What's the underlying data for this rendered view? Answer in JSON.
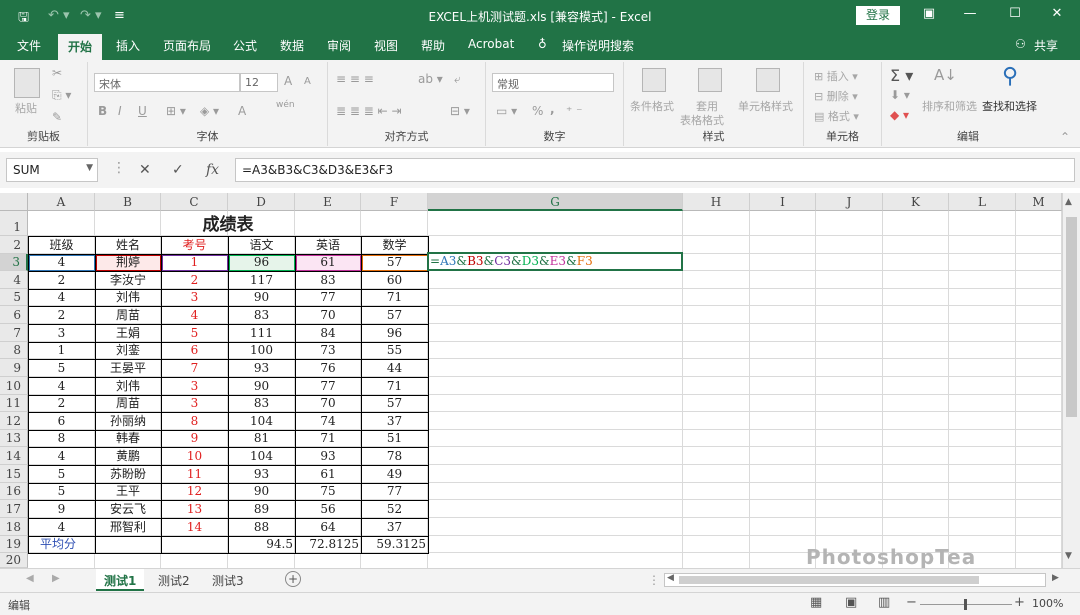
{
  "app": {
    "title": "EXCEL上机测试题.xls [兼容模式] - Excel",
    "login": "登录",
    "share": "共享",
    "tell_me": "操作说明搜索"
  },
  "ribbon_tabs": [
    "文件",
    "开始",
    "插入",
    "页面布局",
    "公式",
    "数据",
    "审阅",
    "视图",
    "帮助",
    "Acrobat"
  ],
  "ribbon": {
    "clipboard": {
      "label": "剪贴板",
      "paste": "粘贴"
    },
    "font": {
      "label": "字体",
      "name": "宋体",
      "size": "12",
      "bold": "B",
      "italic": "I",
      "underline": "U",
      "grow": "A",
      "shrink": "A",
      "color": "A",
      "wen": "wén"
    },
    "alignment": {
      "label": "对齐方式"
    },
    "number": {
      "label": "数字",
      "format": "常规",
      "percent": "%",
      "comma": ","
    },
    "styles": {
      "label": "样式",
      "cond": "条件格式",
      "table": "套用",
      "table2": "表格格式",
      "cell": "单元格样式"
    },
    "cells": {
      "label": "单元格",
      "insert": "插入",
      "delete": "删除",
      "format": "格式"
    },
    "editing": {
      "label": "编辑",
      "sort": "排序和筛选",
      "find": "查找和选择"
    }
  },
  "formula_bar": {
    "name_box": "SUM",
    "cancel": "✕",
    "enter": "✓",
    "fx": "fx",
    "formula": "=A3&B3&C3&D3&E3&F3"
  },
  "columns": [
    "A",
    "B",
    "C",
    "D",
    "E",
    "F",
    "G",
    "H",
    "I",
    "J",
    "K",
    "L",
    "M"
  ],
  "rows": [
    "1",
    "2",
    "3",
    "4",
    "5",
    "6",
    "7",
    "8",
    "9",
    "10",
    "11",
    "12",
    "13",
    "14",
    "15",
    "16",
    "17",
    "18",
    "19",
    "20"
  ],
  "sheet": {
    "title": "成绩表",
    "headers": [
      "班级",
      "姓名",
      "考号",
      "语文",
      "英语",
      "数学"
    ],
    "data": [
      [
        "4",
        "荆婷",
        "1",
        "96",
        "61",
        "57"
      ],
      [
        "2",
        "李汝宁",
        "2",
        "117",
        "83",
        "60"
      ],
      [
        "4",
        "刘伟",
        "3",
        "90",
        "77",
        "71"
      ],
      [
        "2",
        "周苗",
        "4",
        "83",
        "70",
        "57"
      ],
      [
        "3",
        "王娟",
        "5",
        "111",
        "84",
        "96"
      ],
      [
        "1",
        "刘銮",
        "6",
        "100",
        "73",
        "55"
      ],
      [
        "5",
        "王晏平",
        "7",
        "93",
        "76",
        "44"
      ],
      [
        "4",
        "刘伟",
        "3",
        "90",
        "77",
        "71"
      ],
      [
        "2",
        "周苗",
        "3",
        "83",
        "70",
        "57"
      ],
      [
        "6",
        "孙丽纳",
        "8",
        "104",
        "74",
        "37"
      ],
      [
        "8",
        "韩春",
        "9",
        "81",
        "71",
        "51"
      ],
      [
        "4",
        "黄鹏",
        "10",
        "104",
        "93",
        "78"
      ],
      [
        "5",
        "苏盼盼",
        "11",
        "93",
        "61",
        "49"
      ],
      [
        "5",
        "王平",
        "12",
        "90",
        "75",
        "77"
      ],
      [
        "9",
        "安云飞",
        "13",
        "89",
        "56",
        "52"
      ],
      [
        "4",
        "邢智利",
        "14",
        "88",
        "64",
        "37"
      ]
    ],
    "avg_label": "平均分",
    "averages": [
      "94.5",
      "72.8125",
      "59.3125"
    ]
  },
  "formula_cell": [
    {
      "text": "=",
      "color": "#217346"
    },
    {
      "text": "A3",
      "color": "#2e75b6"
    },
    {
      "text": "&",
      "color": "#217346"
    },
    {
      "text": "B3",
      "color": "#c00000"
    },
    {
      "text": "&",
      "color": "#217346"
    },
    {
      "text": "C3",
      "color": "#7030a0"
    },
    {
      "text": "&",
      "color": "#217346"
    },
    {
      "text": "D3",
      "color": "#00b050"
    },
    {
      "text": "&",
      "color": "#217346"
    },
    {
      "text": "E3",
      "color": "#c0309a"
    },
    {
      "text": "&",
      "color": "#217346"
    },
    {
      "text": "F3",
      "color": "#e36c09"
    }
  ],
  "sheet_tabs": [
    "测试1",
    "测试2",
    "测试3"
  ],
  "status": {
    "mode": "编辑",
    "zoom": "100%"
  },
  "watermark": "PhotoshopTea",
  "colors": {
    "brand": "#217346",
    "red_text": "#e02020",
    "blue_text": "#2e4fb3"
  }
}
